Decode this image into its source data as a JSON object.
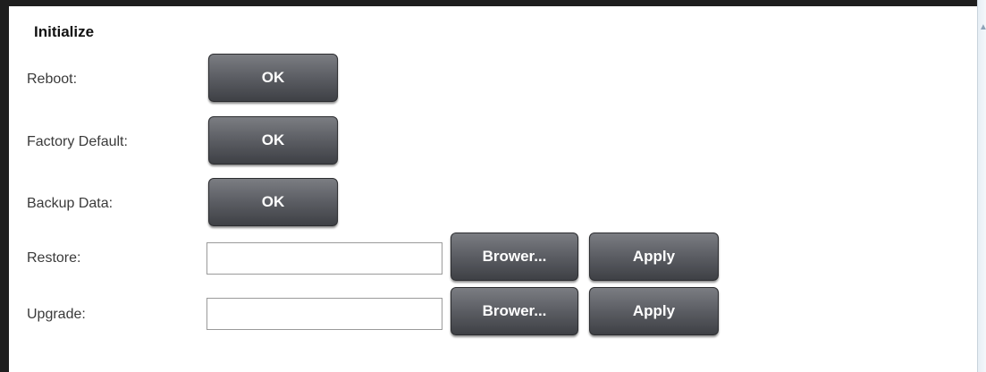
{
  "section": {
    "title": "Initialize"
  },
  "rows": {
    "reboot": {
      "label": "Reboot:",
      "button": "OK"
    },
    "factory_default": {
      "label": "Factory Default:",
      "button": "OK"
    },
    "backup_data": {
      "label": "Backup Data:",
      "button": "OK"
    },
    "restore": {
      "label": "Restore:",
      "value": "",
      "browse_button": "Brower...",
      "apply_button": "Apply"
    },
    "upgrade": {
      "label": "Upgrade:",
      "value": "",
      "browse_button": "Brower...",
      "apply_button": "Apply"
    }
  },
  "colors": {
    "button_top": "#7b7d82",
    "button_bottom": "#3e4045",
    "frame": "#1e1e1e"
  }
}
